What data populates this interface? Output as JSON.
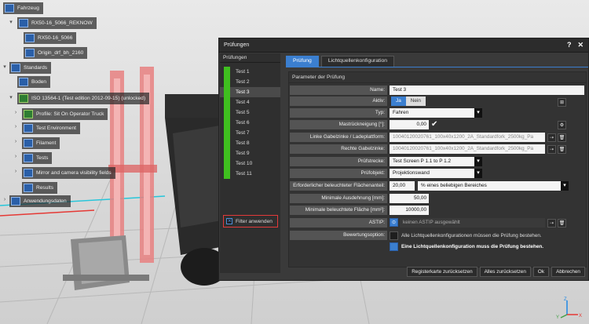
{
  "tree": {
    "items": [
      {
        "label": "Fahrzeug"
      },
      {
        "label": "RX50-16_5066_REKNOW"
      },
      {
        "label": "RX50-16_5066"
      },
      {
        "label": "Origin_drf_bh_2160"
      },
      {
        "label": "Standards"
      },
      {
        "label": "Boden"
      },
      {
        "label": "ISO 13564-1 (Test edition 2012-09-15) (unlocked)"
      },
      {
        "label": "Profile: Sit On Operator Truck"
      },
      {
        "label": "Test Environment"
      },
      {
        "label": "Filament"
      },
      {
        "label": "Tests"
      },
      {
        "label": "Mirror and camera visibility fields"
      },
      {
        "label": "Results"
      },
      {
        "label": "Anwendungsdaten"
      }
    ]
  },
  "dialog": {
    "title": "Prüfungen",
    "help": "?",
    "close": "✕",
    "tests_header": "Prüfungen",
    "tests": [
      "Test 1",
      "Test 2",
      "Test 3",
      "Test 4",
      "Test 5",
      "Test 6",
      "Test 7",
      "Test 8",
      "Test 9",
      "Test 10",
      "Test 11"
    ],
    "filter_label": "Filter anwenden",
    "tabs": [
      "Prüfung",
      "Lichtquellenkonfiguration"
    ],
    "params_title": "Parameter der Prüfung",
    "fields": {
      "name_label": "Name:",
      "name_value": "Test 3",
      "aktiv_label": "Aktiv:",
      "ja": "Ja",
      "nein": "Nein",
      "typ_label": "Typ:",
      "typ_value": "Fahren",
      "mast_label": "Mastrückneigung [°]:",
      "mast_value": "0,00",
      "links_label": "Linke Gabelzinke / Ladeplattform:",
      "links_value": "10040120020761_100x40x1200_2A_Standardfork_2500kg_Pa",
      "rechts_label": "Rechte Gabelzinke:",
      "rechts_value": "10040120020761_100x40x1200_2A_Standardfork_2500kg_Pa",
      "strecke_label": "Prüfstrecke:",
      "strecke_value": "Test Screen P 1.1 to P 1.2",
      "objekt_label": "Prüfobjekt:",
      "objekt_value": "Projektionswand",
      "flaeche_label": "Erforderlicher beleuchteter Flächenanteil:",
      "flaeche_value": "20,00",
      "flaeche_unit": "% eines beliebigen Bereiches",
      "ausdehnung_label": "Minimale Ausdehnung [mm]:",
      "ausdehnung_value": "50,00",
      "beleuchtet_label": "Minimale beleuchtete Fläche [mm²]:",
      "beleuchtet_value": "10000,00",
      "astip_label": "ASTIP:",
      "astip_value": "keinen ASTIP ausgewählt",
      "bewertung_label": "Bewertungsoption:",
      "opt1": "Alle Lichtquellenkonfigurationen müssen die Prüfung bestehen.",
      "opt2": "Eine Lichtquellenkonfiguration muss die Prüfung bestehen."
    },
    "footer": {
      "reset_tab": "Registerkarte zurücksetzen",
      "reset_all": "Alles zurücksetzen",
      "ok": "Ok",
      "cancel": "Abbrechen"
    }
  },
  "axes": {
    "x": "X",
    "y": "Y",
    "z": "Z"
  }
}
